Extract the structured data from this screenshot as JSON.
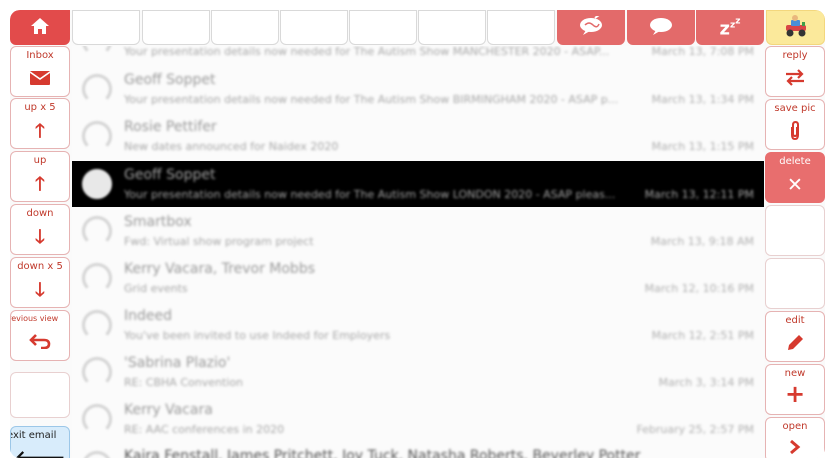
{
  "topbar": {
    "buttons": [
      {
        "icon": "home-icon",
        "style": "home"
      },
      {
        "icon": "",
        "style": "blank"
      },
      {
        "icon": "",
        "style": "blank"
      },
      {
        "icon": "",
        "style": "blank"
      },
      {
        "icon": "",
        "style": "blank"
      },
      {
        "icon": "",
        "style": "blank"
      },
      {
        "icon": "",
        "style": "blank"
      },
      {
        "icon": "",
        "style": "blank"
      },
      {
        "icon": "speech-bubble-scribble-icon",
        "style": "red"
      },
      {
        "icon": "speech-bubble-icon",
        "style": "red"
      },
      {
        "icon": "sleep-zzz-icon",
        "style": "red",
        "text": "z"
      },
      {
        "icon": "toy-car-icon",
        "style": "yellow"
      }
    ]
  },
  "left_column": [
    {
      "label": "Inbox",
      "icon": "envelope-icon"
    },
    {
      "label": "up x 5",
      "icon": "arrow-up-icon"
    },
    {
      "label": "up",
      "icon": "arrow-up-icon"
    },
    {
      "label": "down",
      "icon": "arrow-down-icon"
    },
    {
      "label": "down x 5",
      "icon": "arrow-down-icon"
    },
    {
      "label": "previous view",
      "icon": "return-arrow-icon"
    },
    {
      "label": "",
      "icon": ""
    },
    {
      "label": "exit email",
      "icon": "arrow-left-icon"
    }
  ],
  "right_column": [
    {
      "label": "reply",
      "icon": "swap-arrows-icon"
    },
    {
      "label": "save pic",
      "icon": "paperclip-icon"
    },
    {
      "label": "delete",
      "icon": "close-x-icon"
    },
    {
      "label": "",
      "icon": ""
    },
    {
      "label": "",
      "icon": ""
    },
    {
      "label": "edit",
      "icon": "pencil-icon"
    },
    {
      "label": "new",
      "icon": "plus-icon"
    },
    {
      "label": "open",
      "icon": "chevron-right-icon"
    }
  ],
  "emails": [
    {
      "sender": "",
      "subject": "Your presentation details now needed for The Autism Show MANCHESTER 2020 - ASAP...",
      "time": "March 13, 7:08 PM"
    },
    {
      "sender": "Geoff Soppet",
      "subject": "Your presentation details now needed for The Autism Show BIRMINGHAM 2020 - ASAP p...",
      "time": "March 13, 1:34 PM"
    },
    {
      "sender": "Rosie Pettifer",
      "subject": "New dates announced for Naidex 2020",
      "time": "March 13, 1:15 PM"
    },
    {
      "sender": "Geoff Soppet",
      "subject": "Your presentation details now needed for The Autism Show LONDON 2020 - ASAP pleas...",
      "time": "March 13, 12:11 PM"
    },
    {
      "sender": "Smartbox",
      "subject": "Fwd: Virtual show program project",
      "time": "March 13, 9:18 AM"
    },
    {
      "sender": "Kerry Vacara, Trevor Mobbs",
      "subject": "Grid events",
      "time": "March 12, 10:16 PM"
    },
    {
      "sender": "Indeed",
      "subject": "You've been invited to use Indeed for Employers",
      "time": "March 12, 2:51 PM"
    },
    {
      "sender": "'Sabrina Plazio'",
      "subject": "RE: CBHA Convention",
      "time": "March 3, 3:14 PM"
    },
    {
      "sender": "Kerry Vacara",
      "subject": "RE: AAC conferences in 2020",
      "time": "February 25, 2:57 PM"
    },
    {
      "sender": "Kaira Fenstall, James Pritchett, Joy Tuck, Natasha Roberts, Beverley Potter",
      "subject": "",
      "time": ""
    }
  ],
  "selected_index": 3,
  "colors": {
    "accent_red": "#e24b4b",
    "button_red": "#e36a6a",
    "label_red": "#c0392b",
    "selected_row": "#000000",
    "exit_blue": "#d8ecfb",
    "yellow": "#fbe99b"
  }
}
